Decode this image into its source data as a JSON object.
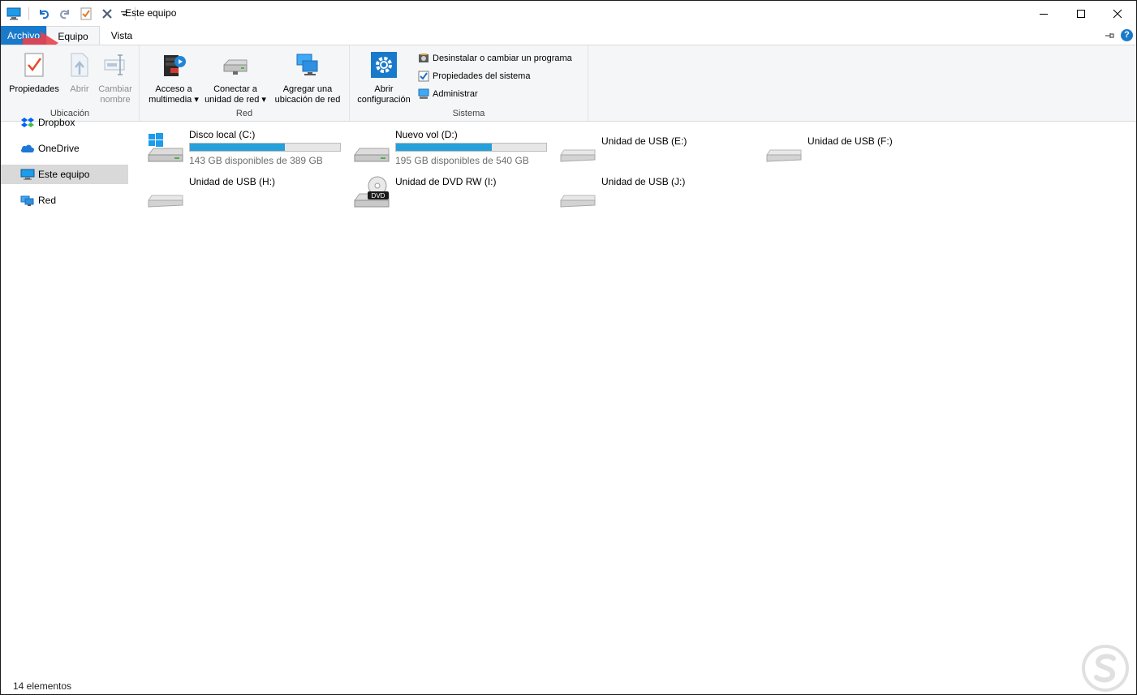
{
  "window": {
    "title": "Este equipo",
    "controls": {
      "minimize": "—",
      "maximize": "☐",
      "close": "✕"
    }
  },
  "qat": {
    "icons": [
      "computer-icon",
      "undo-icon",
      "redo-icon",
      "properties-check-icon",
      "delete-x-icon",
      "dropdown-icon"
    ]
  },
  "tabs": {
    "file": "Archivo",
    "equipo": "Equipo",
    "vista": "Vista"
  },
  "ribbon": {
    "ubicacion": {
      "label": "Ubicación",
      "propiedades": "Propiedades",
      "abrir": "Abrir",
      "cambiar_nombre_1": "Cambiar",
      "cambiar_nombre_2": "nombre"
    },
    "red": {
      "label": "Red",
      "acceso_1": "Acceso a",
      "acceso_2": "multimedia",
      "conectar_1": "Conectar a",
      "conectar_2": "unidad de red",
      "agregar_1": "Agregar una",
      "agregar_2": "ubicación de red"
    },
    "sistema": {
      "label": "Sistema",
      "abrir_conf_1": "Abrir",
      "abrir_conf_2": "configuración",
      "desinstalar": "Desinstalar o cambiar un programa",
      "propiedades_sistema": "Propiedades del sistema",
      "administrar": "Administrar"
    }
  },
  "nav": {
    "items": [
      {
        "label": "Dropbox"
      },
      {
        "label": "OneDrive"
      },
      {
        "label": "Este equipo"
      },
      {
        "label": "Red"
      }
    ]
  },
  "drives": [
    {
      "name": "Disco local (C:)",
      "free": "143 GB disponibles de 389 GB",
      "used_fraction": 0.632
    },
    {
      "name": "Nuevo vol (D:)",
      "free": "195 GB disponibles de 540 GB",
      "used_fraction": 0.639
    },
    {
      "name": "Unidad de USB (E:)"
    },
    {
      "name": "Unidad de USB (F:)"
    },
    {
      "name": "Unidad de USB (H:)"
    },
    {
      "name": "Unidad de DVD RW (I:)",
      "badge": "DVD"
    },
    {
      "name": "Unidad de USB (J:)"
    }
  ],
  "status": {
    "count": "14 elementos"
  },
  "colors": {
    "accent": "#1979ca",
    "bar_fill": "#26a0da",
    "annotation_arrow": "#e8414c"
  }
}
